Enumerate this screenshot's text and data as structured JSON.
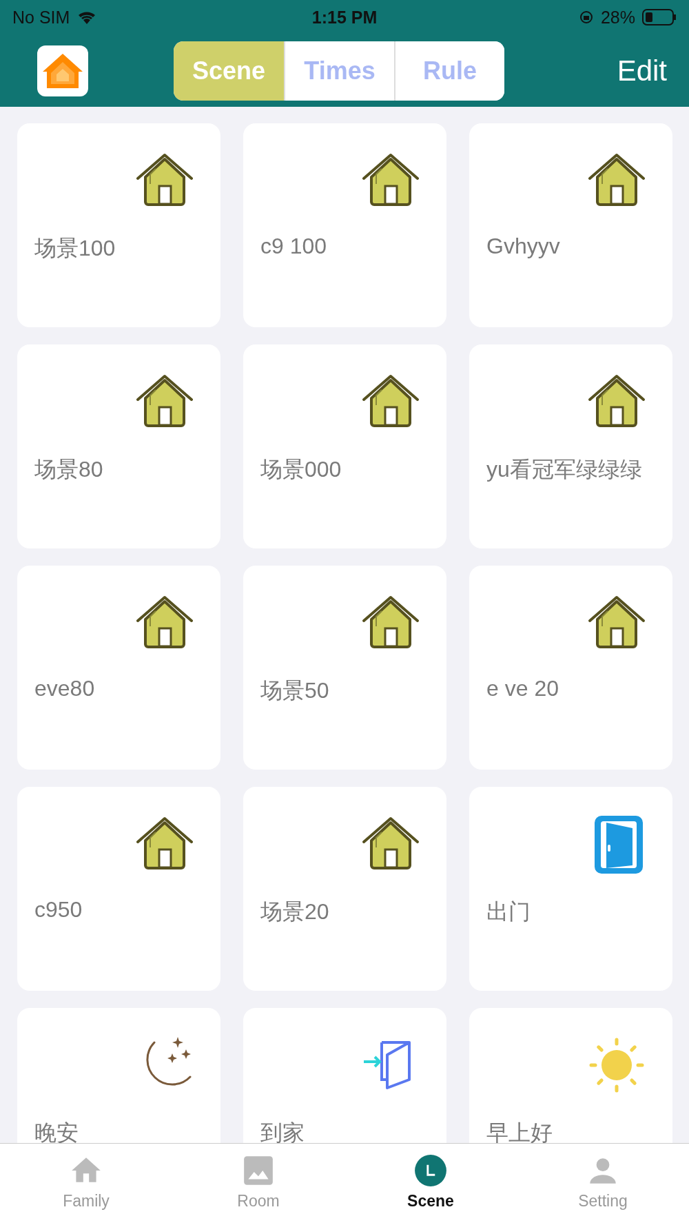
{
  "status_bar": {
    "carrier": "No SIM",
    "time": "1:15 PM",
    "battery": "28%"
  },
  "header": {
    "tabs": [
      {
        "label": "Scene",
        "selected": true
      },
      {
        "label": "Times",
        "selected": false
      },
      {
        "label": "Rule",
        "selected": false
      }
    ],
    "edit": "Edit"
  },
  "scenes": [
    {
      "name": "场景100",
      "kind": "house"
    },
    {
      "name": "c9 100",
      "kind": "house"
    },
    {
      "name": "Gvhyyv",
      "kind": "house"
    },
    {
      "name": "场景80",
      "kind": "house"
    },
    {
      "name": "场景000",
      "kind": "house"
    },
    {
      "name": "yu看冠军绿绿绿",
      "kind": "house"
    },
    {
      "name": "eve80",
      "kind": "house"
    },
    {
      "name": "场景50",
      "kind": "house"
    },
    {
      "name": "e ve 20",
      "kind": "house"
    },
    {
      "name": "c950",
      "kind": "house"
    },
    {
      "name": "场景20",
      "kind": "house"
    },
    {
      "name": "出门",
      "kind": "leave"
    },
    {
      "name": "晚安",
      "kind": "moon"
    },
    {
      "name": "到家",
      "kind": "arrive"
    },
    {
      "name": "早上好",
      "kind": "sun"
    }
  ],
  "tab_bar": [
    {
      "label": "Family",
      "kind": "home",
      "selected": false
    },
    {
      "label": "Room",
      "kind": "image",
      "selected": false
    },
    {
      "label": "Scene",
      "kind": "clock",
      "selected": true
    },
    {
      "label": "Setting",
      "kind": "person",
      "selected": false
    }
  ]
}
